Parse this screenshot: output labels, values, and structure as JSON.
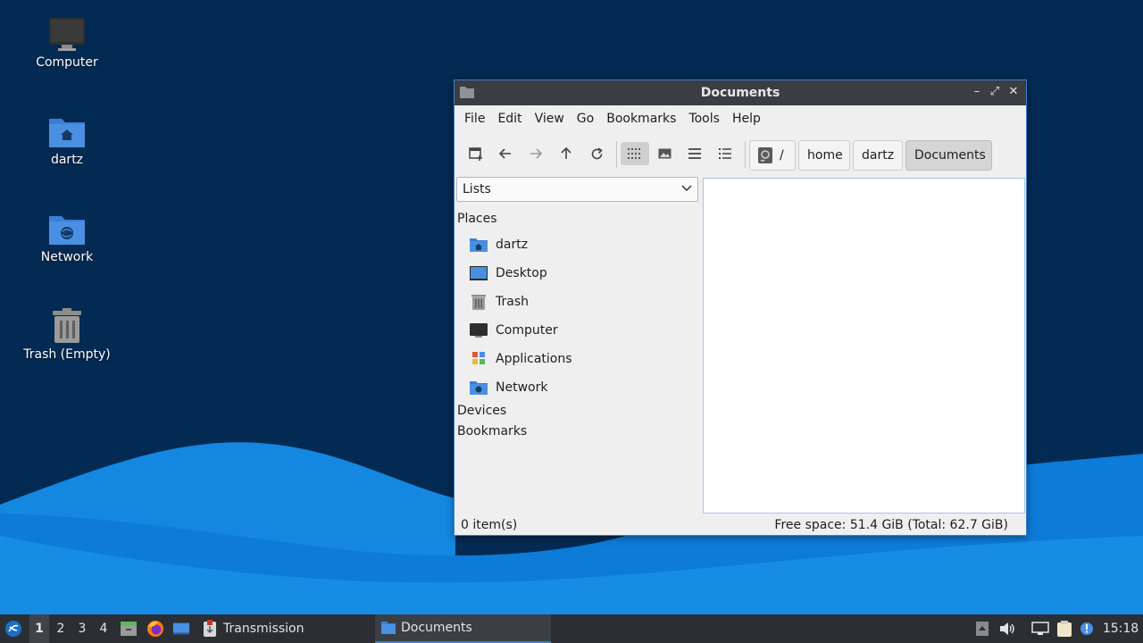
{
  "desktop": {
    "icons": [
      {
        "label": "Computer",
        "icon": "computer-icon"
      },
      {
        "label": "dartz",
        "icon": "home-folder-icon"
      },
      {
        "label": "Network",
        "icon": "network-folder-icon"
      },
      {
        "label": "Trash (Empty)",
        "icon": "trash-icon"
      }
    ]
  },
  "window": {
    "title": "Documents",
    "controls": {
      "minimize": "–",
      "maximize": "⤢",
      "close": "✕"
    },
    "menu": [
      "File",
      "Edit",
      "View",
      "Go",
      "Bookmarks",
      "Tools",
      "Help"
    ],
    "toolbar": {
      "buttons": [
        "new-tab-icon",
        "back-icon",
        "forward-icon",
        "up-icon",
        "reload-icon",
        "icon-view-icon",
        "image-view-icon",
        "compact-list-icon",
        "detailed-list-icon"
      ],
      "active_view": "icon-view"
    },
    "path": {
      "root": "/",
      "segments": [
        "home",
        "dartz",
        "Documents"
      ],
      "current": "Documents"
    },
    "sidebar": {
      "selector": "Lists",
      "places_heading": "Places",
      "places": [
        {
          "label": "dartz",
          "icon": "home-folder-icon"
        },
        {
          "label": "Desktop",
          "icon": "desktop-icon"
        },
        {
          "label": "Trash",
          "icon": "trash-icon"
        },
        {
          "label": "Computer",
          "icon": "computer-icon"
        },
        {
          "label": "Applications",
          "icon": "applications-icon"
        },
        {
          "label": "Network",
          "icon": "network-folder-icon"
        }
      ],
      "devices_heading": "Devices",
      "bookmarks_heading": "Bookmarks"
    },
    "status": {
      "items": "0 item(s)",
      "free_space": "Free space: 51.4 GiB (Total: 62.7 GiB)"
    }
  },
  "taskbar": {
    "workspaces": [
      "1",
      "2",
      "3",
      "4"
    ],
    "active_workspace": "1",
    "apps": [
      {
        "label": "Transmission",
        "icon": "transmission-icon"
      },
      {
        "label": "Documents",
        "icon": "folder-icon"
      }
    ],
    "clock": "15:18"
  },
  "colors": {
    "accent": "#3a7fd0",
    "desktop_bg": "#032a52",
    "wave": "#1a8fe8",
    "titlebar": "#3a3d42",
    "taskbar": "#2b2e33"
  }
}
